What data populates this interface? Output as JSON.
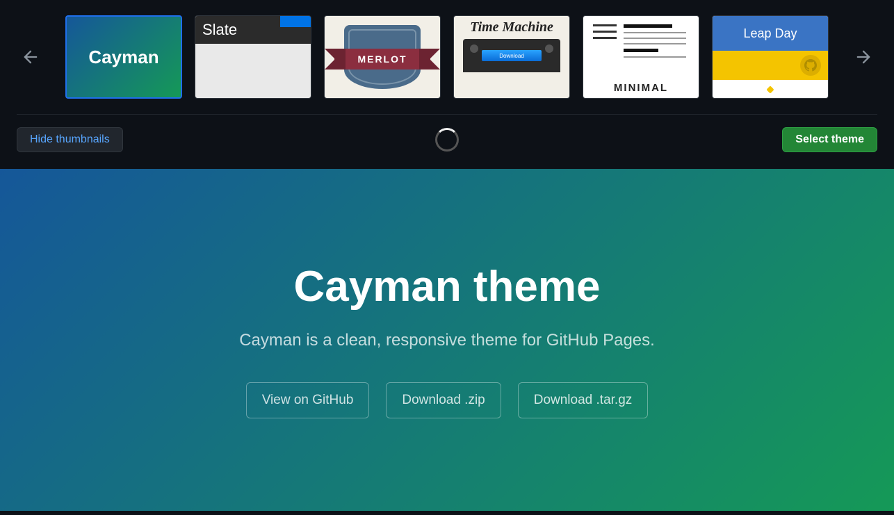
{
  "themes": [
    {
      "id": "cayman",
      "label": "Cayman",
      "selected": true
    },
    {
      "id": "slate",
      "label": "Slate",
      "selected": false
    },
    {
      "id": "merlot",
      "label": "MERLOT",
      "selected": false
    },
    {
      "id": "timemachine",
      "label": "Time Machine",
      "selected": false,
      "download_label": "Download"
    },
    {
      "id": "minimal",
      "label": "MINIMAL",
      "selected": false
    },
    {
      "id": "leapday",
      "label": "Leap Day",
      "selected": false
    }
  ],
  "toolbar": {
    "hide_label": "Hide thumbnails",
    "select_label": "Select theme"
  },
  "preview": {
    "title": "Cayman theme",
    "subtitle": "Cayman is a clean, responsive theme for GitHub Pages.",
    "buttons": [
      "View on GitHub",
      "Download .zip",
      "Download .tar.gz"
    ]
  }
}
